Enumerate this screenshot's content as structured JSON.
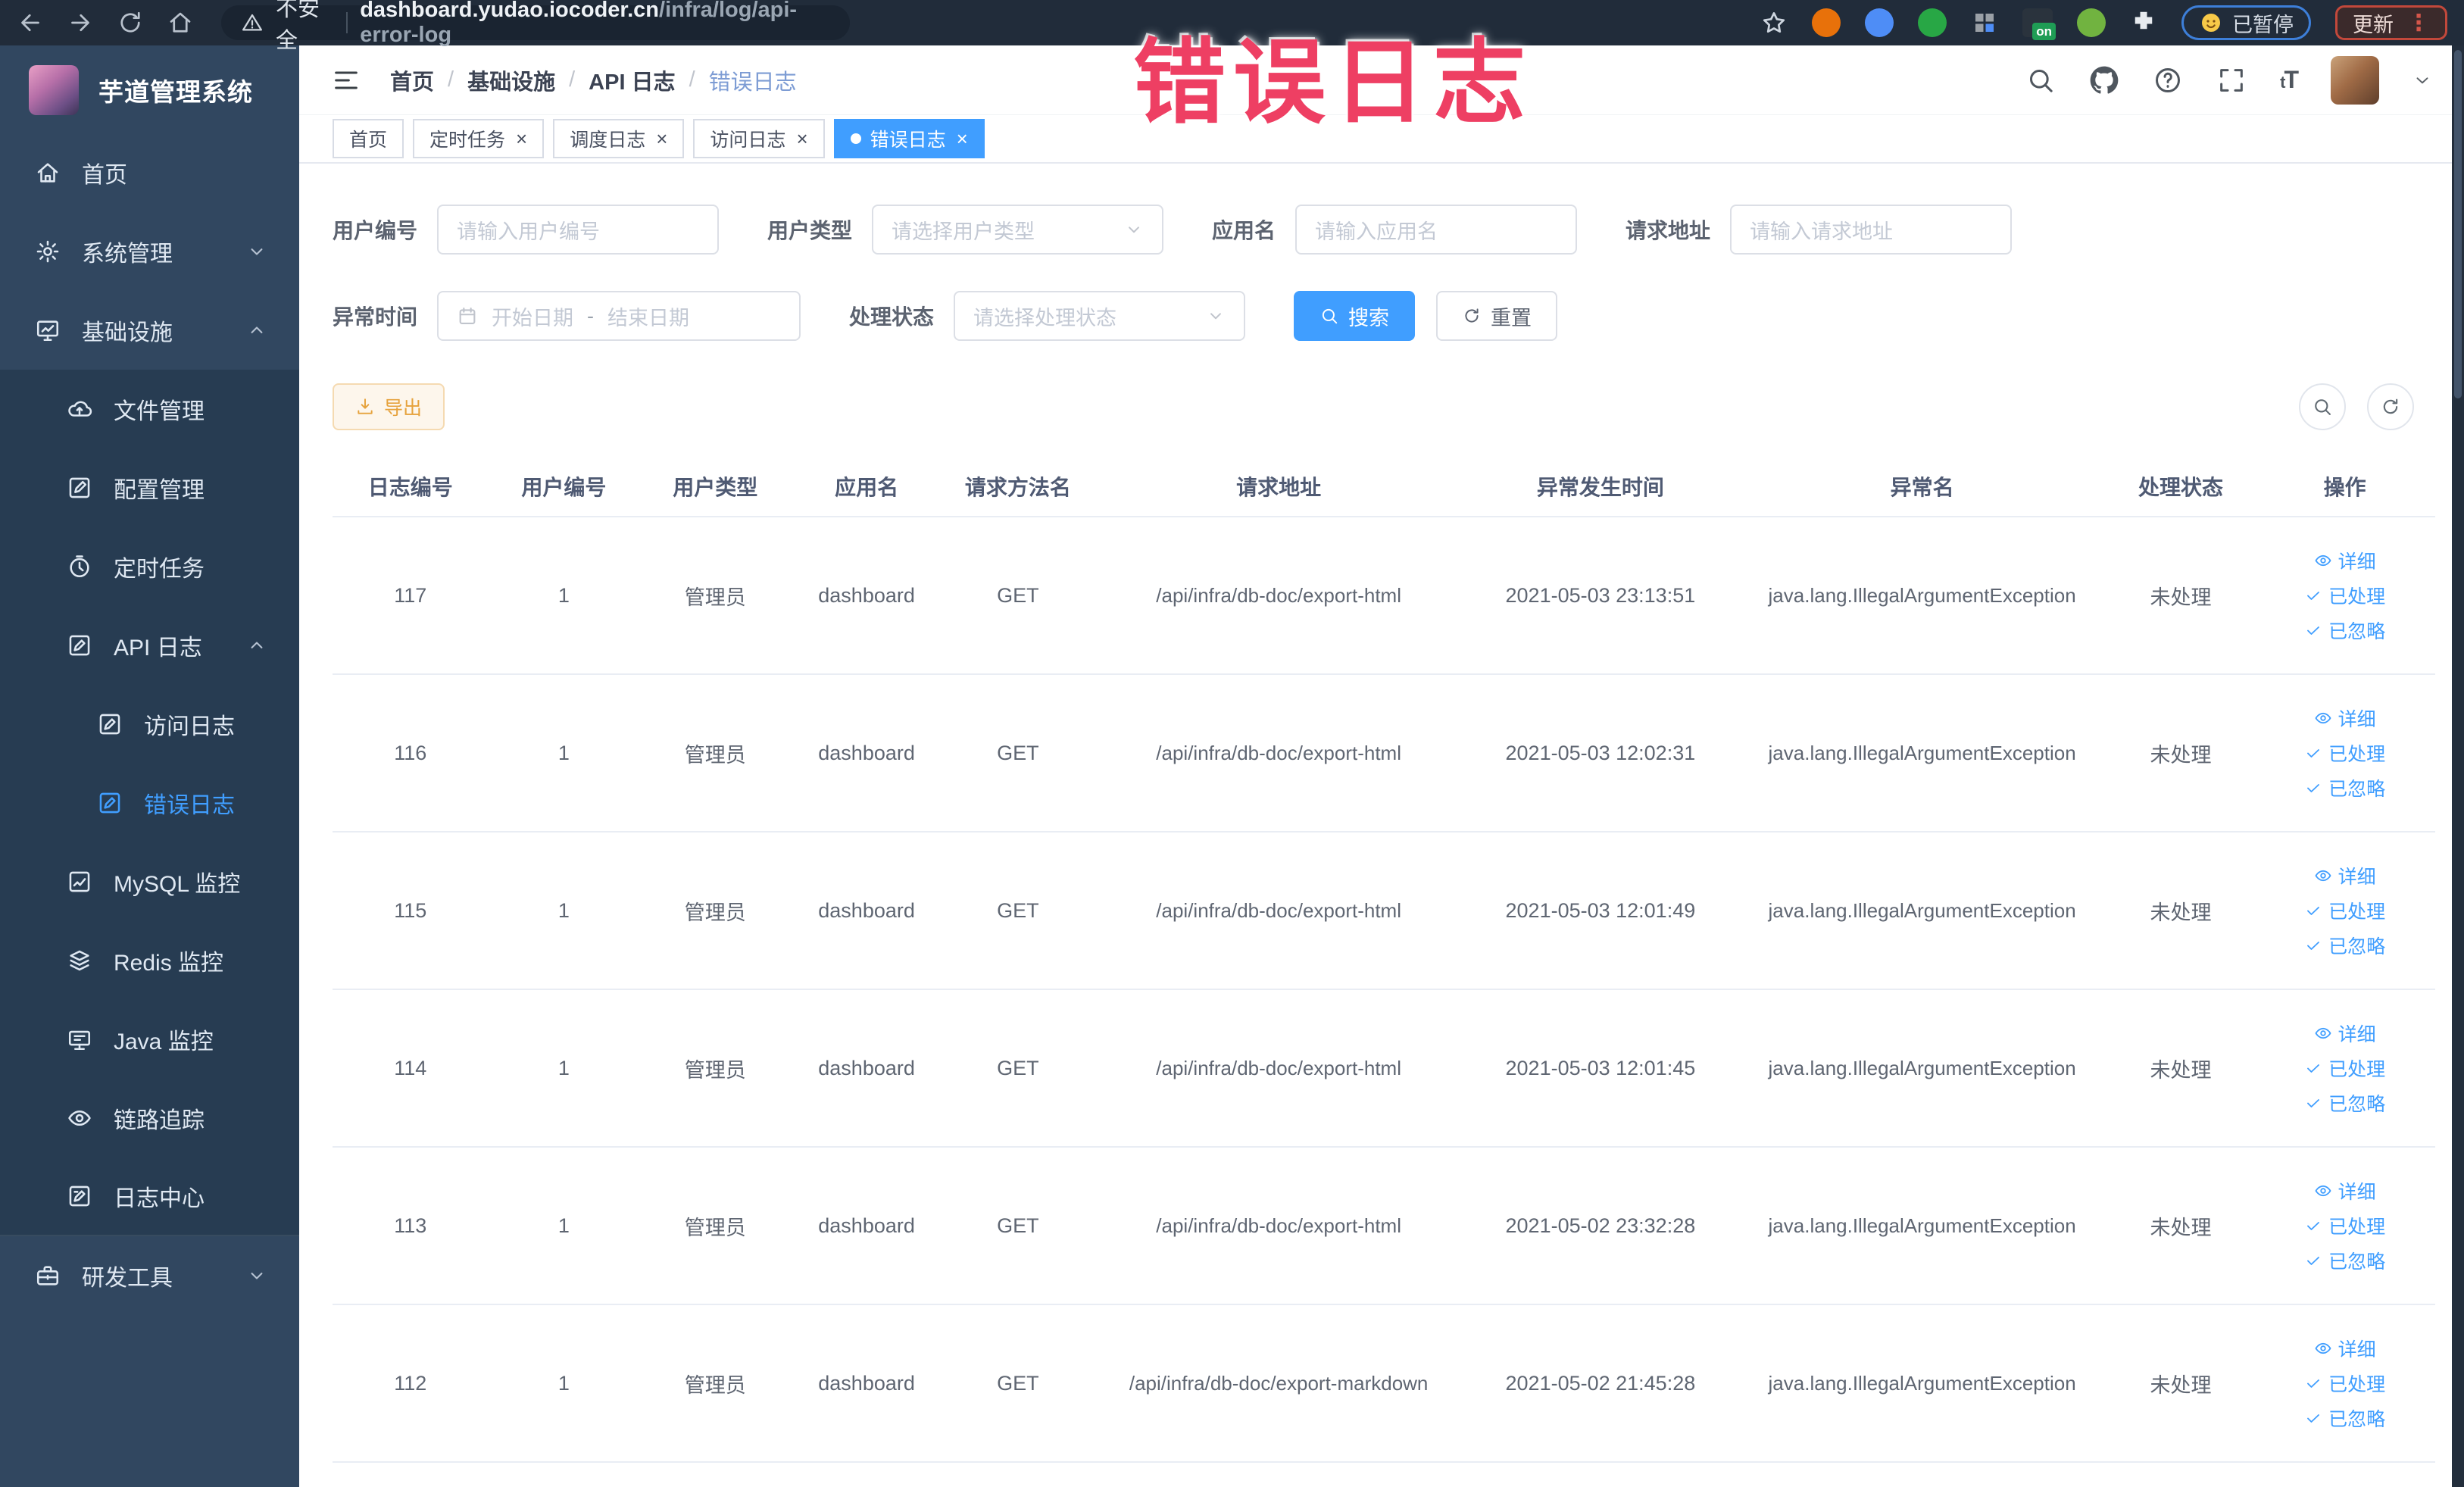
{
  "browser": {
    "security_label": "不安全",
    "url_host": "dashboard.yudao.iocoder.cn",
    "url_path": "/infra/log/api-error-log",
    "paused_label": "已暂停",
    "update_label": "更新"
  },
  "annotation": {
    "text": "错误日志",
    "color": "#ee3f63"
  },
  "sidebar": {
    "title": "芋道管理系统",
    "items": [
      {
        "label": "首页",
        "icon": "home-icon",
        "level": 1
      },
      {
        "label": "系统管理",
        "icon": "gear-icon",
        "level": 1,
        "chevron": "down"
      },
      {
        "label": "基础设施",
        "icon": "infra-icon",
        "level": 1,
        "chevron": "up"
      },
      {
        "label": "文件管理",
        "icon": "file-icon",
        "level": 2,
        "section": true
      },
      {
        "label": "配置管理",
        "icon": "config-icon",
        "level": 2,
        "section": true
      },
      {
        "label": "定时任务",
        "icon": "timer-icon",
        "level": 2,
        "section": true
      },
      {
        "label": "API 日志",
        "icon": "log-icon",
        "level": 2,
        "section": true,
        "chevron": "up"
      },
      {
        "label": "访问日志",
        "icon": "log-icon",
        "level": 3,
        "section": true
      },
      {
        "label": "错误日志",
        "icon": "log-icon",
        "level": 3,
        "section": true,
        "active": true
      },
      {
        "label": "MySQL 监控",
        "icon": "mysql-icon",
        "level": 2,
        "section": true
      },
      {
        "label": "Redis 监控",
        "icon": "redis-icon",
        "level": 2,
        "section": true
      },
      {
        "label": "Java 监控",
        "icon": "java-icon",
        "level": 2,
        "section": true
      },
      {
        "label": "链路追踪",
        "icon": "trace-icon",
        "level": 2,
        "section": true
      },
      {
        "label": "日志中心",
        "icon": "logcenter-icon",
        "level": 2,
        "section": true
      },
      {
        "label": "研发工具",
        "icon": "devtools-icon",
        "level": 1,
        "chevron": "down"
      }
    ]
  },
  "breadcrumb": [
    "首页",
    "基础设施",
    "API 日志",
    "错误日志"
  ],
  "header_icons": [
    "search-icon",
    "github-icon",
    "help-icon",
    "fullscreen-icon"
  ],
  "fontsize_icon_label": "tT",
  "tabs": [
    {
      "label": "首页",
      "closable": false,
      "active": false
    },
    {
      "label": "定时任务",
      "closable": true,
      "active": false
    },
    {
      "label": "调度日志",
      "closable": true,
      "active": false
    },
    {
      "label": "访问日志",
      "closable": true,
      "active": false
    },
    {
      "label": "错误日志",
      "closable": true,
      "active": true
    }
  ],
  "filters": {
    "user_id": {
      "label": "用户编号",
      "placeholder": "请输入用户编号"
    },
    "user_type": {
      "label": "用户类型",
      "placeholder": "请选择用户类型"
    },
    "app_name": {
      "label": "应用名",
      "placeholder": "请输入应用名"
    },
    "request_url": {
      "label": "请求地址",
      "placeholder": "请输入请求地址"
    },
    "exception_time": {
      "label": "异常时间",
      "start_placeholder": "开始日期",
      "separator": "-",
      "end_placeholder": "结束日期"
    },
    "process_status": {
      "label": "处理状态",
      "placeholder": "请选择处理状态"
    },
    "search_label": "搜索",
    "reset_label": "重置"
  },
  "toolbar": {
    "export_label": "导出"
  },
  "table": {
    "columns": [
      "日志编号",
      "用户编号",
      "用户类型",
      "应用名",
      "请求方法名",
      "请求地址",
      "异常发生时间",
      "异常名",
      "处理状态",
      "操作"
    ],
    "actions": [
      "详细",
      "已处理",
      "已忽略"
    ],
    "rows": [
      {
        "id": "117",
        "user_id": "1",
        "user_type": "管理员",
        "app": "dashboard",
        "method": "GET",
        "url": "/api/infra/db-doc/export-html",
        "time": "2021-05-03 23:13:51",
        "exception": "java.lang.IllegalArgumentException",
        "status": "未处理"
      },
      {
        "id": "116",
        "user_id": "1",
        "user_type": "管理员",
        "app": "dashboard",
        "method": "GET",
        "url": "/api/infra/db-doc/export-html",
        "time": "2021-05-03 12:02:31",
        "exception": "java.lang.IllegalArgumentException",
        "status": "未处理"
      },
      {
        "id": "115",
        "user_id": "1",
        "user_type": "管理员",
        "app": "dashboard",
        "method": "GET",
        "url": "/api/infra/db-doc/export-html",
        "time": "2021-05-03 12:01:49",
        "exception": "java.lang.IllegalArgumentException",
        "status": "未处理"
      },
      {
        "id": "114",
        "user_id": "1",
        "user_type": "管理员",
        "app": "dashboard",
        "method": "GET",
        "url": "/api/infra/db-doc/export-html",
        "time": "2021-05-03 12:01:45",
        "exception": "java.lang.IllegalArgumentException",
        "status": "未处理"
      },
      {
        "id": "113",
        "user_id": "1",
        "user_type": "管理员",
        "app": "dashboard",
        "method": "GET",
        "url": "/api/infra/db-doc/export-html",
        "time": "2021-05-02 23:32:28",
        "exception": "java.lang.IllegalArgumentException",
        "status": "未处理"
      },
      {
        "id": "112",
        "user_id": "1",
        "user_type": "管理员",
        "app": "dashboard",
        "method": "GET",
        "url": "/api/infra/db-doc/export-markdown",
        "time": "2021-05-02 21:45:28",
        "exception": "java.lang.IllegalArgumentException",
        "status": "未处理"
      }
    ]
  },
  "colors": {
    "accent": "#409eff",
    "warning": "#e6a23c",
    "sidebar_bg": "#314760",
    "annotation": "#ee3f63"
  }
}
